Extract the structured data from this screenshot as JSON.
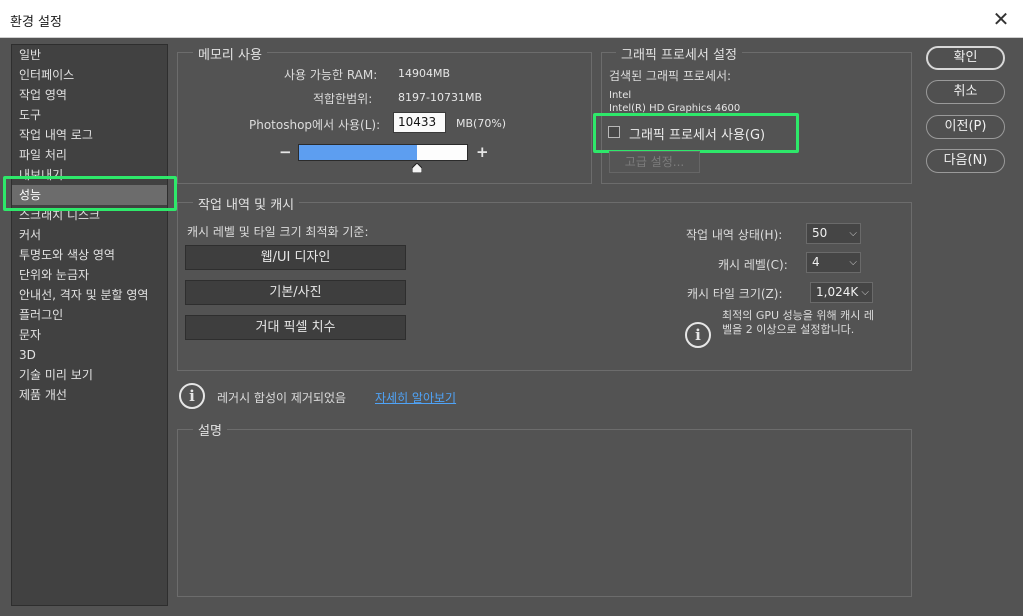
{
  "window": {
    "title": "환경 설정",
    "close_glyph": "✕"
  },
  "sidebar": {
    "items": [
      {
        "label": "일반"
      },
      {
        "label": "인터페이스"
      },
      {
        "label": "작업 영역"
      },
      {
        "label": "도구"
      },
      {
        "label": "작업 내역 로그"
      },
      {
        "label": "파일 처리"
      },
      {
        "label": "내보내기"
      },
      {
        "label": "성능",
        "selected": true
      },
      {
        "label": "스크래치 디스크"
      },
      {
        "label": "커서"
      },
      {
        "label": "투명도와 색상 영역"
      },
      {
        "label": "단위와 눈금자"
      },
      {
        "label": "안내선, 격자 및 분할 영역"
      },
      {
        "label": "플러그인"
      },
      {
        "label": "문자"
      },
      {
        "label": "3D"
      },
      {
        "label": "기술 미리 보기"
      },
      {
        "label": "제품 개선"
      }
    ]
  },
  "memory": {
    "title": "메모리 사용",
    "available_label": "사용 가능한 RAM:",
    "available_value": "14904MB",
    "ideal_label": "적합한범위:",
    "ideal_value": "8197-10731MB",
    "use_label": "Photoshop에서 사용(L):",
    "use_value": "10433",
    "use_suffix": "MB(70%)",
    "minus_glyph": "−",
    "plus_glyph": "+",
    "slider_fraction": 0.7
  },
  "gpu": {
    "title": "그래픽 프로세서 설정",
    "detected_label": "검색된 그래픽 프로세서:",
    "vendor": "Intel",
    "model": "Intel(R) HD Graphics 4600",
    "use_gpu_label": "그래픽 프로세서 사용(G)",
    "use_gpu_checked": false,
    "advanced_label": "고급 설정..."
  },
  "cache": {
    "title": "작업 내역 및 캐시",
    "optimize_label": "캐시 레벨 및 타일 크기 최적화 기준:",
    "presets": [
      "웹/UI 디자인",
      "기본/사진",
      "거대 픽셀 치수"
    ],
    "history_label": "작업 내역 상태(H):",
    "history_value": "50",
    "levels_label": "캐시 레벨(C):",
    "levels_value": "4",
    "tile_label": "캐시 타일 크기(Z):",
    "tile_value": "1,024K",
    "gpu_note_line1": "최적의 GPU 성능을 위해 캐시 레",
    "gpu_note_line2": "벨을 2 이상으로 설정합니다."
  },
  "legacy": {
    "text": "레거시 합성이 제거되었음",
    "link": "자세히 알아보기"
  },
  "description": {
    "title": "설명"
  },
  "buttons": {
    "ok": "확인",
    "cancel": "취소",
    "prev": "이전(P)",
    "next": "다음(N)"
  },
  "colors": {
    "highlight": "#2ee86a",
    "slider_fill": "#5d9ef0",
    "link": "#4fa3f7",
    "panel_bg": "#535353"
  }
}
